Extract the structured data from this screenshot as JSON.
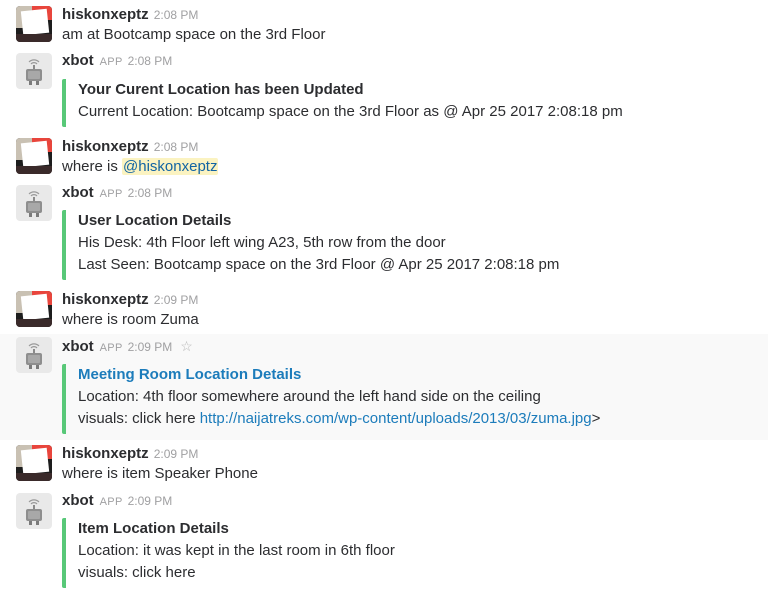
{
  "messages": [
    {
      "user": "hiskonxeptz",
      "time": "2:08 PM",
      "text": "am at Bootcamp space on the 3rd Floor"
    },
    {
      "user": "xbot",
      "badge": "APP",
      "time": "2:08 PM",
      "attachment": {
        "title": "Your Curent Location has been Updated",
        "lines": [
          "Current Location: Bootcamp space on the 3rd Floor as @ Apr 25 2017 2:08:18 pm"
        ]
      }
    },
    {
      "user": "hiskonxeptz",
      "time": "2:08 PM",
      "text_prefix": "where is ",
      "mention": "@hiskonxeptz"
    },
    {
      "user": "xbot",
      "badge": "APP",
      "time": "2:08 PM",
      "attachment": {
        "title": "User Location Details",
        "lines": [
          "His Desk: 4th Floor left wing A23, 5th row from the door",
          "Last Seen: Bootcamp space on the 3rd Floor @ Apr 25 2017 2:08:18 pm"
        ]
      }
    },
    {
      "user": "hiskonxeptz",
      "time": "2:09 PM",
      "text": "where is room Zuma"
    },
    {
      "user": "xbot",
      "badge": "APP",
      "time": "2:09 PM",
      "star_icon": "star-outline-icon",
      "attachment": {
        "title": "Meeting Room Location Details",
        "lines": [
          "Location: 4th floor somewhere around the left hand side on the ceiling"
        ],
        "visuals_prefix": "visuals: click here ",
        "visuals_url": "http://naijatreks.com/wp-content/uploads/2013/03/zuma.jpg",
        "visuals_suffix": ">"
      }
    },
    {
      "user": "hiskonxeptz",
      "time": "2:09 PM",
      "text": "where is item Speaker Phone"
    },
    {
      "user": "xbot",
      "badge": "APP",
      "time": "2:09 PM",
      "attachment": {
        "title": "Item Location Details",
        "lines": [
          "Location: it was kept in the last room in 6th floor",
          "visuals: click here"
        ]
      }
    }
  ],
  "colors": {
    "attachment_bar": "#58c878",
    "link": "#1c7cbb",
    "mention_bg": "#fbf3c1",
    "hover_row": "#f9f9f9"
  }
}
